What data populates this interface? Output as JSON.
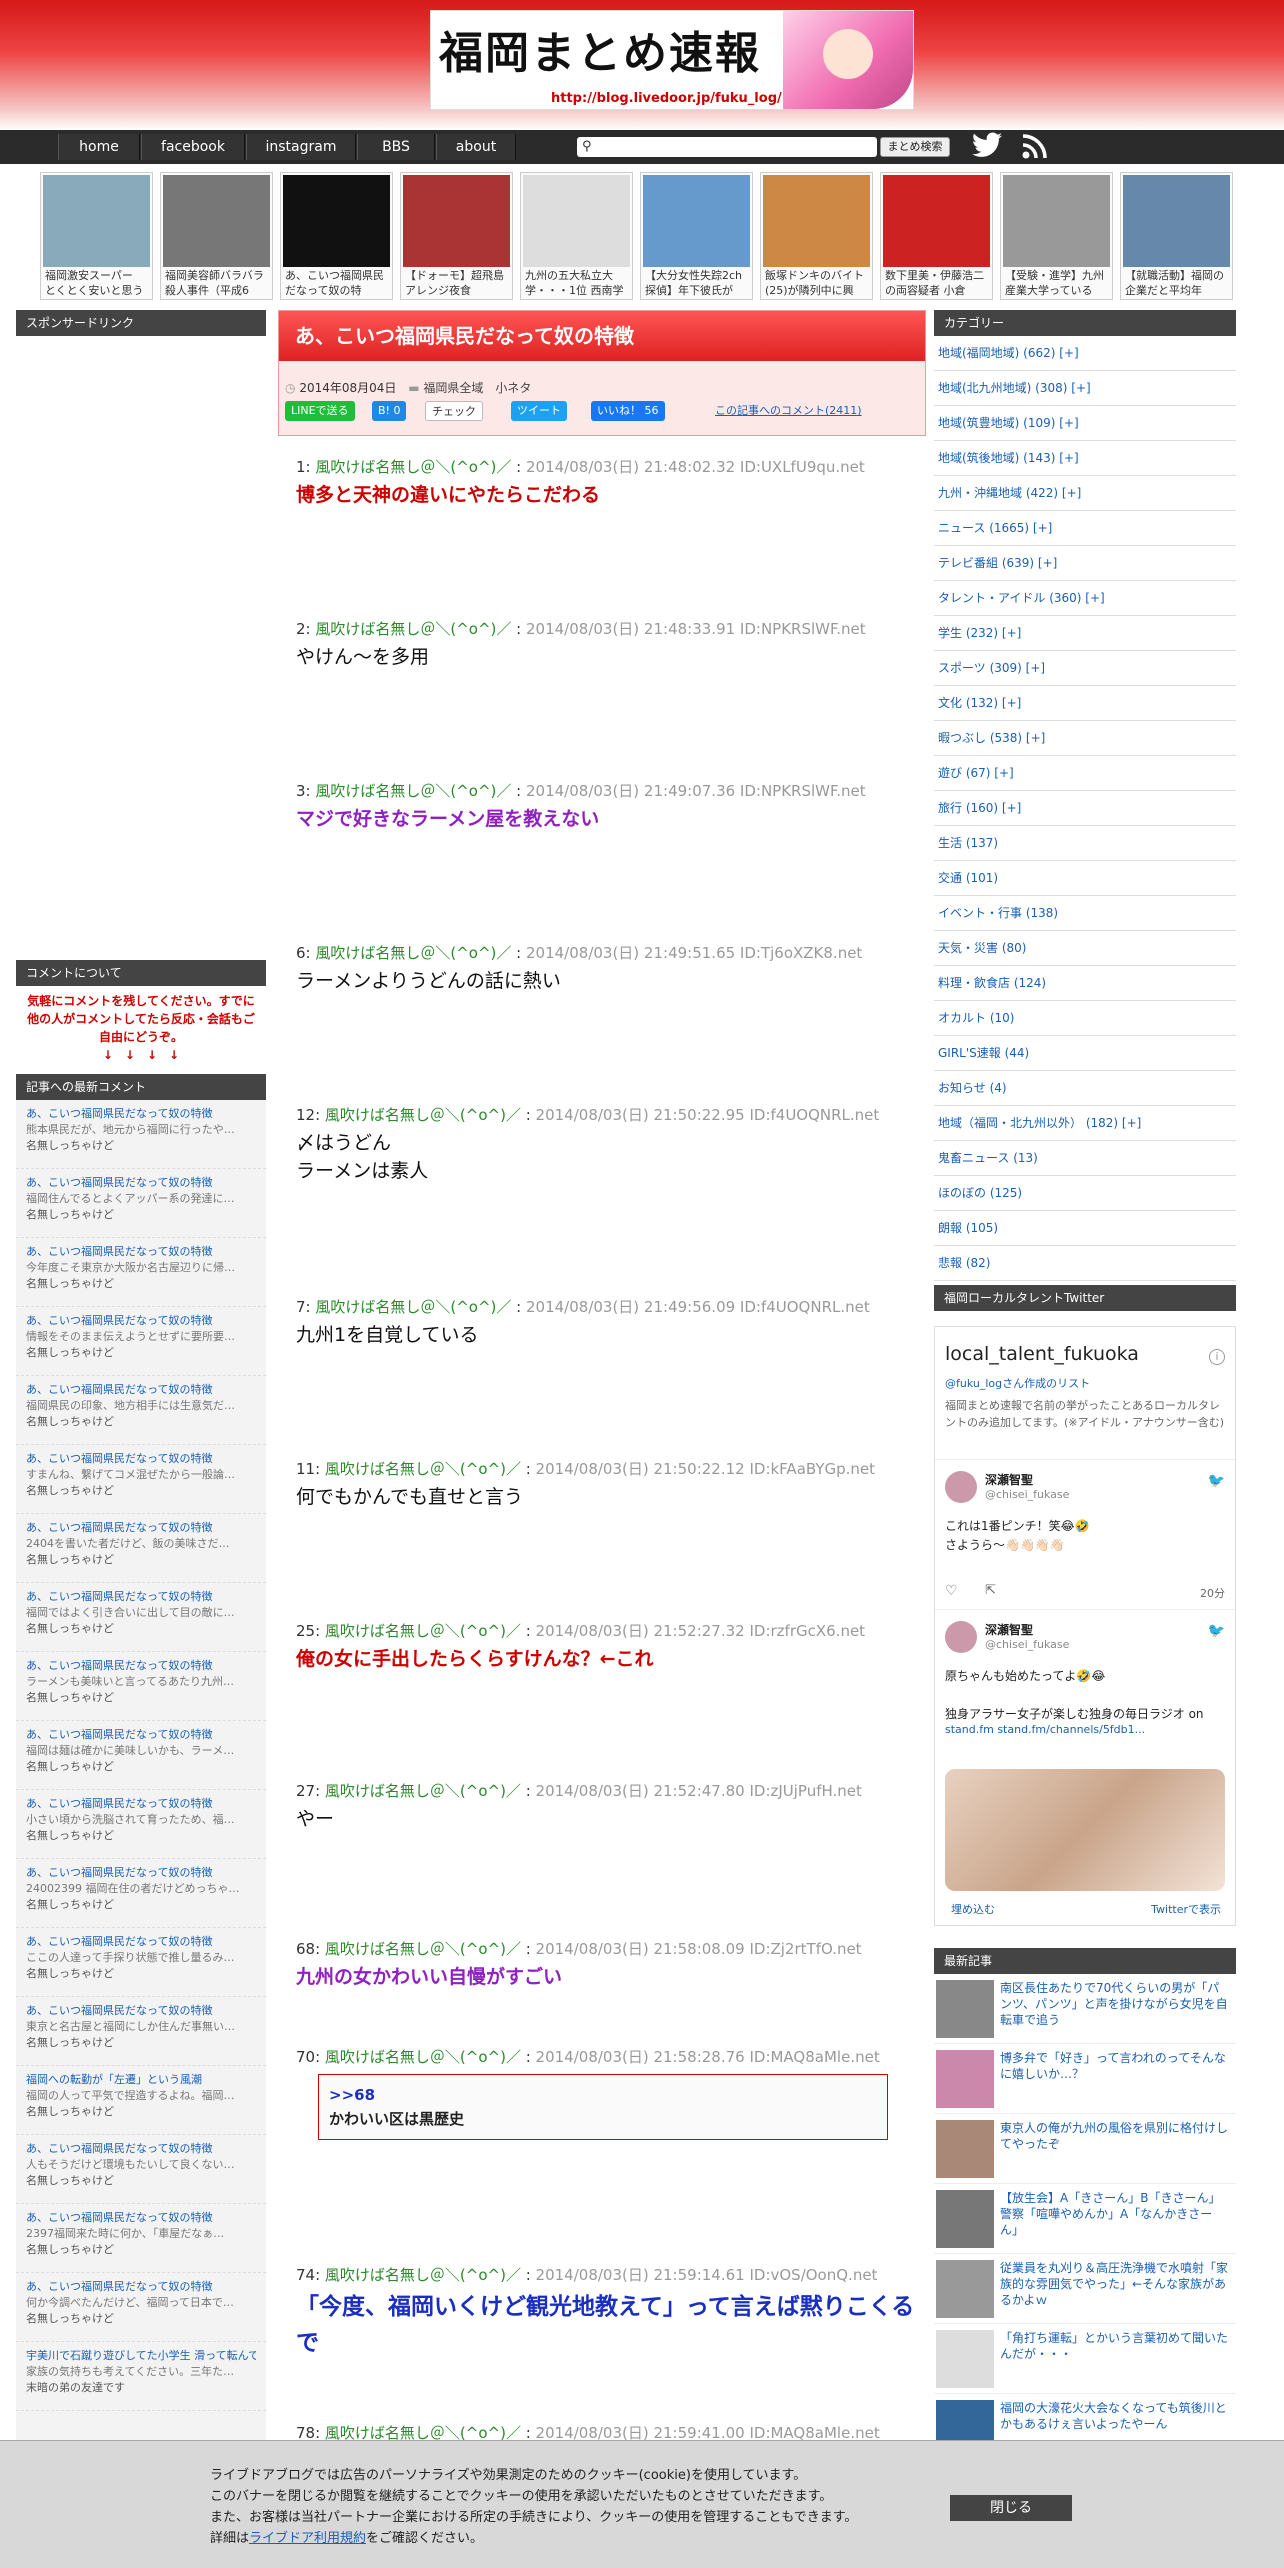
{
  "header": {
    "banner_title": "福岡まとめ速報",
    "banner_url": "http://blog.livedoor.jp/fuku_log/"
  },
  "nav": {
    "items": [
      "home",
      "facebook",
      "instagram",
      "BBS",
      "about"
    ],
    "search_button": "まとめ検索"
  },
  "thumbs": [
    {
      "caption": "福岡激安スーパー　とくとく安いと思う",
      "color": "#8ab"
    },
    {
      "caption": "福岡美容師バラバラ殺人事件（平成6",
      "color": "#777"
    },
    {
      "caption": "あ、こいつ福岡県民だなって奴の特",
      "color": "#111"
    },
    {
      "caption": "【ドォーモ】超飛島アレンジ夜食",
      "color": "#a33"
    },
    {
      "caption": "九州の五大私立大学・・・1位 西南学",
      "color": "#ddd"
    },
    {
      "caption": "【大分女性失踪2ch探偵】年下彼氏が",
      "color": "#69c"
    },
    {
      "caption": "飯塚ドンキのバイト(25)が隣列中に興",
      "color": "#c84"
    },
    {
      "caption": "数下里美・伊藤浩二の両容疑者 小倉",
      "color": "#c22"
    },
    {
      "caption": "【受験・進学】九州産業大学っている",
      "color": "#999"
    },
    {
      "caption": "【就職活動】福岡の企業だと平均年",
      "color": "#68a"
    },
    {
      "caption": "【就職活動】福岡の企業だと平均年",
      "color": "#243"
    }
  ],
  "left": {
    "sponsor_header": "スポンサードリンク",
    "comment_about_header": "コメントについて",
    "comment_notice": "気軽にコメントを残してください。すでに他の人がコメントしてたら反応・会話もご自由にどうぞ。\n↓　↓　↓　↓",
    "recent_header": "記事への最新コメント",
    "recent": [
      {
        "title": "あ、こいつ福岡県民だなって奴の特徴",
        "body": "熊本県民だが、地元から福岡に行ったや…",
        "name": "名無しっちゃけど"
      },
      {
        "title": "あ、こいつ福岡県民だなって奴の特徴",
        "body": "福岡住んでるとよくアッパー系の発達に…",
        "name": "名無しっちゃけど"
      },
      {
        "title": "あ、こいつ福岡県民だなって奴の特徴",
        "body": "今年度こそ東京か大阪か名古屋辺りに帰…",
        "name": "名無しっちゃけど"
      },
      {
        "title": "あ、こいつ福岡県民だなって奴の特徴",
        "body": "情報をそのまま伝えようとせずに要所要…",
        "name": "名無しっちゃけど"
      },
      {
        "title": "あ、こいつ福岡県民だなって奴の特徴",
        "body": "福岡県民の印象、地方相手には生意気だ…",
        "name": "名無しっちゃけど"
      },
      {
        "title": "あ、こいつ福岡県民だなって奴の特徴",
        "body": "すまんね、繋げてコメ混ぜたから一般論…",
        "name": "名無しっちゃけど"
      },
      {
        "title": "あ、こいつ福岡県民だなって奴の特徴",
        "body": "2404を書いた者だけど、飯の美味さだ…",
        "name": "名無しっちゃけど"
      },
      {
        "title": "あ、こいつ福岡県民だなって奴の特徴",
        "body": "福岡ではよく引き合いに出して目の敵に…",
        "name": "名無しっちゃけど"
      },
      {
        "title": "あ、こいつ福岡県民だなって奴の特徴",
        "body": "ラーメンも美味いと言ってるあたり九州…",
        "name": "名無しっちゃけど"
      },
      {
        "title": "あ、こいつ福岡県民だなって奴の特徴",
        "body": "福岡は麺は確かに美味しいかも、ラーメ…",
        "name": "名無しっちゃけど"
      },
      {
        "title": "あ、こいつ福岡県民だなって奴の特徴",
        "body": "小さい頃から洗脳されて育ったため、福…",
        "name": "名無しっちゃけど"
      },
      {
        "title": "あ、こいつ福岡県民だなって奴の特徴",
        "body": "24002399 福岡在住の者だけどめっちゃ…",
        "name": "名無しっちゃけど"
      },
      {
        "title": "あ、こいつ福岡県民だなって奴の特徴",
        "body": "ここの人達って手探り状態で推し量るみ…",
        "name": "名無しっちゃけど"
      },
      {
        "title": "あ、こいつ福岡県民だなって奴の特徴",
        "body": "東京と名古屋と福岡にしか住んだ事無い…",
        "name": "名無しっちゃけど"
      },
      {
        "title": "福岡への転勤が「左遷」という風潮",
        "body": "福岡の人って平気で捏造するよね。福岡…",
        "name": "名無しっちゃけど"
      },
      {
        "title": "あ、こいつ福岡県民だなって奴の特徴",
        "body": "人もそうだけど環境もたいして良くない…",
        "name": "名無しっちゃけど"
      },
      {
        "title": "あ、こいつ福岡県民だなって奴の特徴",
        "body": "2397福岡来た時に何か、「車屋だなぁ…",
        "name": "名無しっちゃけど"
      },
      {
        "title": "あ、こいつ福岡県民だなって奴の特徴",
        "body": "何か今調べたんだけど、福岡って日本で…",
        "name": "名無しっちゃけど"
      },
      {
        "title": "宇美川で石蹴り遊びしてた小学生 滑って転んで溺れる",
        "body": "家族の気持ちも考えてください。三年た…",
        "name": "末暗の弟の友達です"
      }
    ]
  },
  "article": {
    "title": "あ、こいつ福岡県民だなって奴の特徴",
    "date": "2014年08月04日",
    "categories": "福岡県全域　小ネタ",
    "share": {
      "line": "LINEで送る",
      "hatena": "B! 0",
      "check": "チェック",
      "tweet": "ツイート",
      "like": "いいね！ 56"
    },
    "comment_link": "この記事へのコメント(2411)",
    "posts": [
      {
        "no": "1",
        "name": "風吹けば名無し＠＼(^o^)／",
        "info": "2014/08/03(日) 21:48:02.32 ID:UXLfU9qu.net",
        "text": "博多と天神の違いにやたらこだわる",
        "color": "#c00"
      },
      {
        "no": "2",
        "name": "風吹けば名無し＠＼(^o^)／",
        "info": "2014/08/03(日) 21:48:33.91 ID:NPKRSlWF.net",
        "text": "やけん～を多用",
        "color": "#111"
      },
      {
        "no": "3",
        "name": "風吹けば名無し＠＼(^o^)／",
        "info": "2014/08/03(日) 21:49:07.36 ID:NPKRSlWF.net",
        "text": "マジで好きなラーメン屋を教えない",
        "color": "#9020c0"
      },
      {
        "no": "6",
        "name": "風吹けば名無し＠＼(^o^)／",
        "info": "2014/08/03(日) 21:49:51.65 ID:Tj6oXZK8.net",
        "text": "ラーメンよりうどんの話に熱い",
        "color": "#111"
      },
      {
        "no": "12",
        "name": "風吹けば名無し＠＼(^o^)／",
        "info": "2014/08/03(日) 21:50:22.95 ID:f4UOQNRL.net",
        "text": "〆はうどん\nラーメンは素人",
        "color": "#111"
      },
      {
        "no": "7",
        "name": "風吹けば名無し＠＼(^o^)／",
        "info": "2014/08/03(日) 21:49:56.09 ID:f4UOQNRL.net",
        "text": "九州1を自覚している",
        "color": "#111"
      },
      {
        "no": "11",
        "name": "風吹けば名無し＠＼(^o^)／",
        "info": "2014/08/03(日) 21:50:22.12 ID:kFAaBYGp.net",
        "text": "何でもかんでも直せと言う",
        "color": "#111"
      },
      {
        "no": "25",
        "name": "風吹けば名無し＠＼(^o^)／",
        "info": "2014/08/03(日) 21:52:27.32 ID:rzfrGcX6.net",
        "text": "俺の女に手出したらくらすけんな？←これ",
        "color": "#c00"
      },
      {
        "no": "27",
        "name": "風吹けば名無し＠＼(^o^)／",
        "info": "2014/08/03(日) 21:52:47.80 ID:zJUjPufH.net",
        "text": "やー",
        "color": "#111"
      },
      {
        "no": "68",
        "name": "風吹けば名無し＠＼(^o^)／",
        "info": "2014/08/03(日) 21:58:08.09 ID:Zj2rtTfO.net",
        "text": "九州の女かわいい自慢がすごい",
        "color": "#9020c0"
      },
      {
        "no": "70",
        "name": "風吹けば名無し＠＼(^o^)／",
        "info": "2014/08/03(日) 21:58:28.76 ID:MAQ8aMle.net",
        "text": "",
        "color": "#111"
      },
      {
        "no": "74",
        "name": "風吹けば名無し＠＼(^o^)／",
        "info": "2014/08/03(日) 21:59:14.61 ID:vOS/OonQ.net",
        "text": "「今度、福岡いくけど観光地教えて」って言えば黙りこくるで",
        "color": "#1a2fc0"
      },
      {
        "no": "78",
        "name": "風吹けば名無し＠＼(^o^)／",
        "info": "2014/08/03(日) 21:59:41.00 ID:MAQ8aMle.net",
        "text": "",
        "color": "#111"
      }
    ],
    "quote": {
      "anchor": ">>68",
      "text": "かわいい区は黒歴史"
    }
  },
  "right": {
    "category_header": "カテゴリー",
    "categories": [
      "地域(福岡地域) (662) [+]",
      "地域(北九州地域) (308) [+]",
      "地域(筑豊地域) (109) [+]",
      "地域(筑後地域) (143) [+]",
      "九州・沖縄地域 (422) [+]",
      "ニュース (1665) [+]",
      "テレビ番組 (639) [+]",
      "タレント・アイドル (360) [+]",
      "学生 (232) [+]",
      "スポーツ (309) [+]",
      "文化 (132) [+]",
      "暇つぶし (538) [+]",
      "遊び (67) [+]",
      "旅行 (160) [+]",
      "生活 (137)",
      "交通 (101)",
      "イベント・行事 (138)",
      "天気・災害 (80)",
      "料理・飲食店 (124)",
      "オカルト (10)",
      "GIRL'S速報 (44)",
      "お知らせ (4)",
      "地域（福岡・北九州以外） (182) [+]",
      "鬼畜ニュース (13)",
      "ほのぼの (125)",
      "朗報 (105)",
      "悲報 (82)"
    ],
    "twitter_header": "福岡ローカルタレントTwitter",
    "twitter": {
      "list_name": "local_talent_fukuoka",
      "by": "@fuku_logさん作成のリスト",
      "desc": "福岡まとめ速報で名前の挙がったことあるローカルタレントのみ追加してます。(※アイドル・アナウンサー含む)",
      "tweets": [
        {
          "name": "深瀬智聖",
          "handle": "@chisei_fukase",
          "text": "これは1番ピンチ！笑😂🤣\nさようら〜👋🏻👋🏻👋🏻👋🏻",
          "time": "20分"
        },
        {
          "name": "深瀬智聖",
          "handle": "@chisei_fukase",
          "text": "原ちゃんも始めたってよ🤣😂\n\n独身アラサー女子が楽しむ独身の毎日ラジオ on",
          "link": "stand.fm stand.fm/channels/5fdb1..."
        }
      ],
      "embed": "埋め込む",
      "view": "Twitterで表示"
    },
    "latest_header": "最新記事",
    "latest": [
      "南区長住あたりで70代くらいの男が「パンツ、パンツ」と声を掛けながら女児を自転車で追う",
      "博多弁で「好き」って言われのってそんなに嬉しいか…？",
      "東京人の俺が九州の風俗を県別に格付けしてやったぞ",
      "【放生会】A「きさーん」B「きさーん」警察「喧嘩やめんか」A「なんかきさーん」",
      "従業員を丸刈り＆高圧洗浄機で水噴射「家族的な雰囲気でやった」←そんな家族があるかよｗ",
      "「角打ち運転」とかいう言葉初めて聞いたんだが・・・",
      "福岡の大濠花火大会なくなっても筑後川とかもあるけぇ言いよったやーん"
    ]
  },
  "cookie": {
    "line1": "ライブドアブログでは広告のパーソナライズや効果測定のためのクッキー(cookie)を使用しています。",
    "line2": "このバナーを閉じるか閲覧を継続することでクッキーの使用を承認いただいたものとさせていただきます。",
    "line3": "また、お客様は当社パートナー企業における所定の手続きにより、クッキーの使用を管理することもできます。",
    "line4_pre": "詳細は",
    "line4_link": "ライブドア利用規約",
    "line4_post": "をご確認ください。",
    "close": "閉じる"
  }
}
